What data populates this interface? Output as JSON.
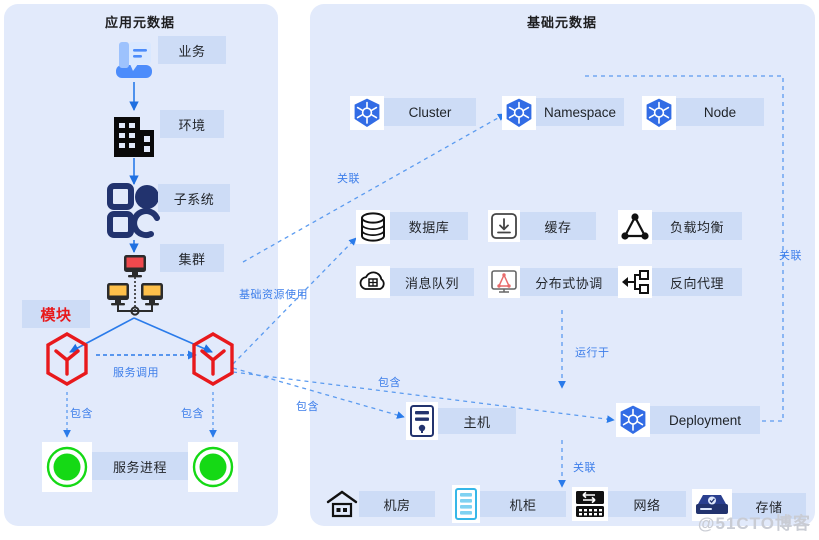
{
  "panels": {
    "app": {
      "title": "应用元数据"
    },
    "infra": {
      "title": "基础元数据"
    }
  },
  "app_nodes": [
    {
      "label": "业务",
      "icon": "book-business-icon"
    },
    {
      "label": "环境",
      "icon": "building-icon"
    },
    {
      "label": "子系统",
      "icon": "subsystem-blocks-icon"
    },
    {
      "label": "集群",
      "icon": "cluster-monitors-icon"
    },
    {
      "label": "模块",
      "icon": "module-hexagon-icon"
    },
    {
      "label": "服务进程",
      "icon": "green-circle-process-icon"
    }
  ],
  "infra_nodes": {
    "k8s_row": [
      {
        "label": "Cluster",
        "icon": "kubernetes-icon"
      },
      {
        "label": "Namespace",
        "icon": "kubernetes-icon"
      },
      {
        "label": "Node",
        "icon": "kubernetes-icon"
      }
    ],
    "service_grid": [
      {
        "label": "数据库",
        "icon": "database-icon"
      },
      {
        "label": "缓存",
        "icon": "cache-download-icon"
      },
      {
        "label": "负载均衡",
        "icon": "load-balancer-icon"
      },
      {
        "label": "消息队列",
        "icon": "message-queue-cloud-icon"
      },
      {
        "label": "分布式协调",
        "icon": "distributed-coordination-icon"
      },
      {
        "label": "反向代理",
        "icon": "reverse-proxy-icon"
      }
    ],
    "host": {
      "label": "主机",
      "icon": "server-host-icon"
    },
    "deployment": {
      "label": "Deployment",
      "icon": "kubernetes-icon"
    },
    "facility_row": [
      {
        "label": "机房",
        "icon": "datacenter-house-icon"
      },
      {
        "label": "机柜",
        "icon": "rack-cabinet-icon"
      },
      {
        "label": "网络",
        "icon": "network-switch-icon"
      },
      {
        "label": "存储",
        "icon": "storage-disk-icon"
      }
    ]
  },
  "edge_labels": {
    "assoc_cluster_namespace": "关联",
    "infra_resource_usage": "基础资源使用",
    "service_call": "服务调用",
    "contains_left": "包含",
    "contains_right": "包含",
    "contains_host": "包含",
    "contains_deployment": "包含",
    "runs_on": "运行于",
    "assoc_deploy_network": "关联",
    "assoc_node_deployment": "关联"
  },
  "watermark": "@51CTO博客",
  "colors": {
    "panel_bg": "#e2eafb",
    "chip_bg": "#cddcf6",
    "accent_blue": "#3d7eea",
    "k8s_blue": "#326ce5",
    "module_red": "#e8191c",
    "process_green": "#15d915",
    "navy": "#22336e"
  }
}
